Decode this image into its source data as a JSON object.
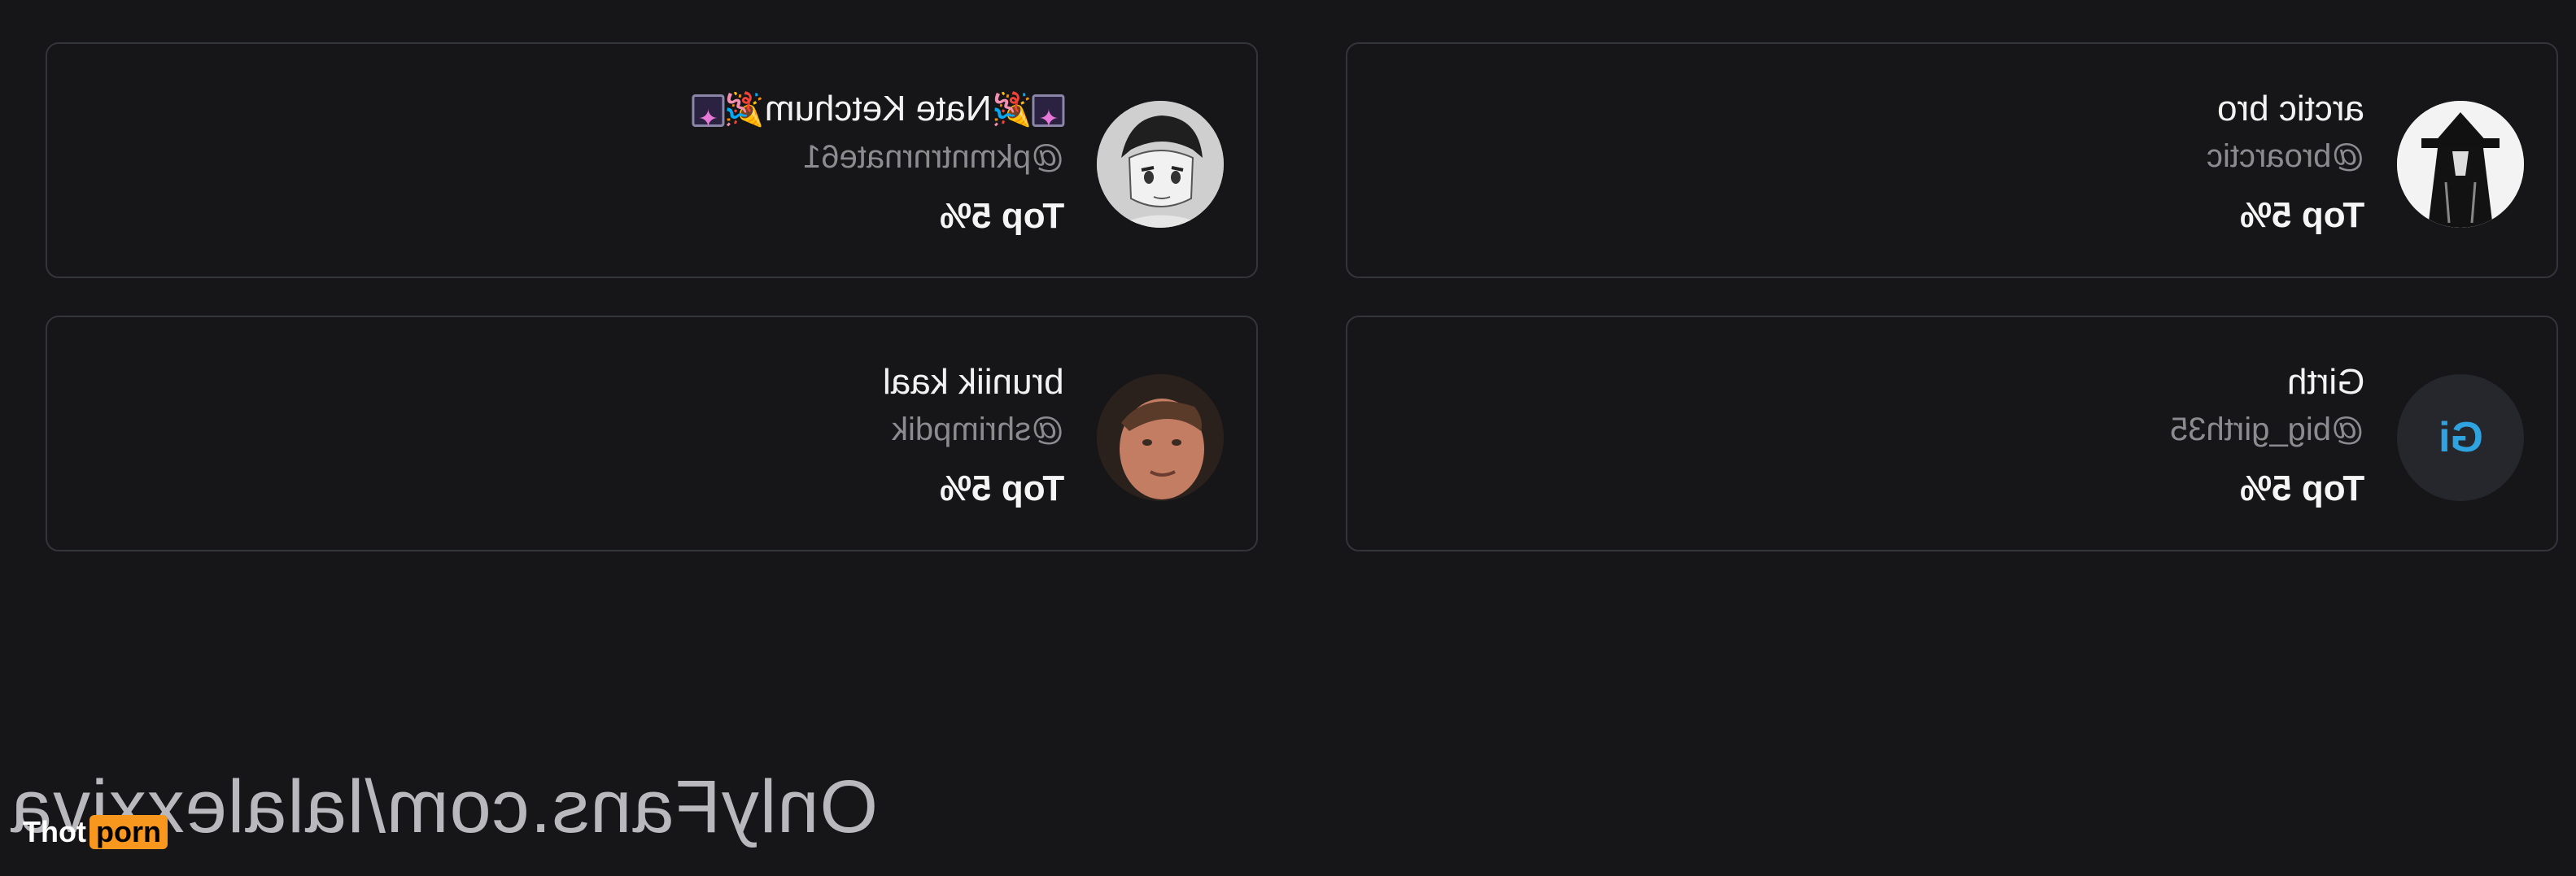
{
  "cards": [
    {
      "name": "🎆🎉Nate Ketchum🎉🎆",
      "name_text": "Nate Ketchum",
      "handle": "@pkmntrnrnate61",
      "rank": "Top 5%",
      "avatar": "anime-character-avatar"
    },
    {
      "name": "arctic bro",
      "handle": "@broarctic",
      "rank": "Top 5%",
      "avatar": "cloaked-figure-avatar"
    },
    {
      "name": "bruniik kaal",
      "handle": "@shrimpdik",
      "rank": "Top 5%",
      "avatar": "person-photo-avatar"
    },
    {
      "name": "Girth",
      "handle": "@big_girth35",
      "rank": "Top 5%",
      "avatar_initials": "Gi"
    }
  ],
  "watermark": "OnlyFans.com/lalalexxiva",
  "badge": {
    "part1": "Thot",
    "part2": "porn"
  },
  "colors": {
    "background": "#161618",
    "card_border": "#34353a",
    "initials": "#2ea3e0",
    "badge_accent": "#f7971d"
  }
}
